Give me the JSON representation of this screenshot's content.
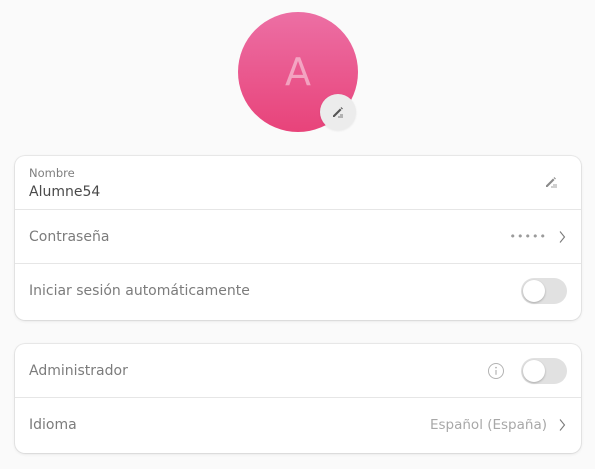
{
  "avatar": {
    "initial": "A",
    "edit_icon": "pencil-icon",
    "gradient_top": "#ec6fa4",
    "gradient_bottom": "#e8437a"
  },
  "account": {
    "name_caption": "Nombre",
    "name_value": "Alumne54",
    "name_edit_icon": "pencil-icon",
    "password_label": "Contraseña",
    "password_mask": "•••••",
    "password_chevron": "chevron-right-icon",
    "autologin_label": "Iniciar sesión automáticamente",
    "autologin_enabled": false
  },
  "permissions": {
    "admin_label": "Administrador",
    "admin_info_icon": "info-icon",
    "admin_enabled": false,
    "language_label": "Idioma",
    "language_value": "Español (España)",
    "language_chevron": "chevron-right-icon"
  }
}
